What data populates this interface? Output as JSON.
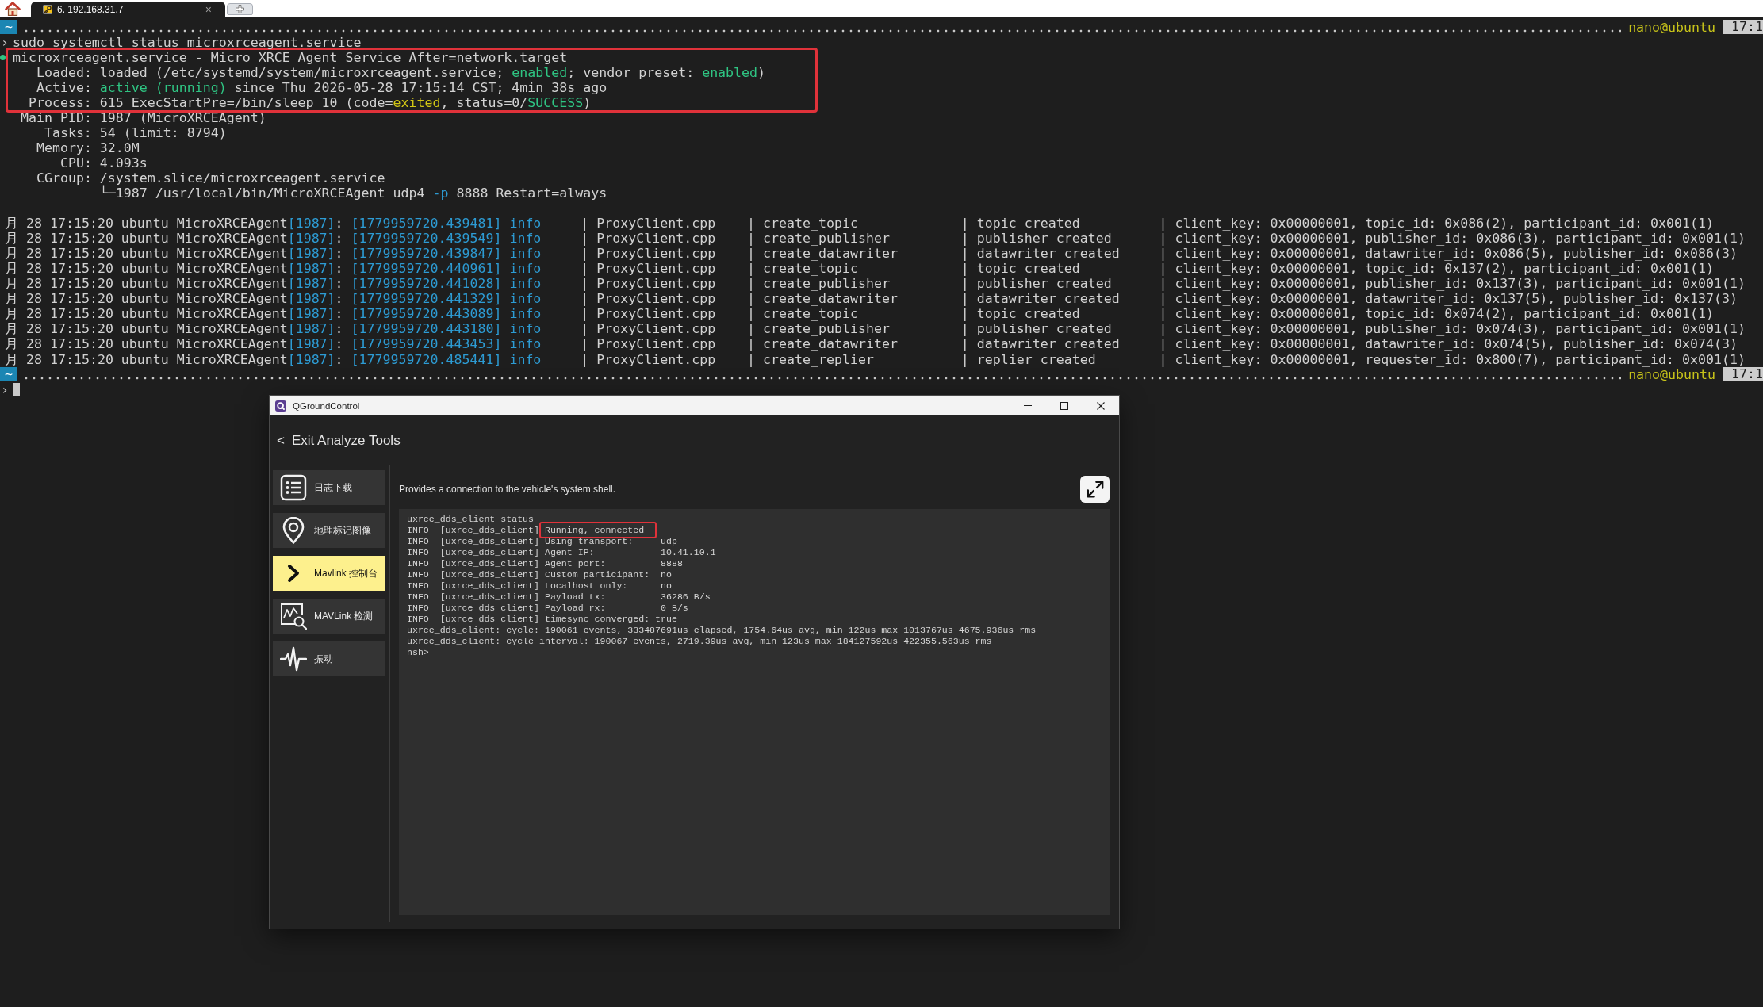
{
  "browser_tabs": [
    {
      "label": "6. 192.168.31.7",
      "close": "×",
      "selected": true
    }
  ],
  "terminal": {
    "lines": [
      {
        "kind": "prompt",
        "dir": "~",
        "user": "nano@ubuntu",
        "time": "17:1"
      },
      {
        "kind": "command",
        "prompt": "›",
        "text": "sudo systemctl status microxrceagent.service"
      },
      {
        "kind": "frame",
        "lines": [
          {
            "kind": "unit",
            "active": true,
            "segments": [
              {
                "kind": "plain",
                "text": "microxrceagent.service - Micro XRCE Agent Service After=network.target"
              }
            ]
          },
          {
            "kind": "field",
            "label": "Loaded:",
            "segments": [
              {
                "kind": "plain",
                "text": "loaded (/etc/systemd/system/microxrceagent.service; "
              },
              {
                "kind": "ok",
                "text": "enabled"
              },
              {
                "kind": "plain",
                "text": "; vendor preset: "
              },
              {
                "kind": "ok",
                "text": "enabled"
              },
              {
                "kind": "plain",
                "text": ")"
              }
            ]
          },
          {
            "kind": "field",
            "label": "Active:",
            "segments": [
              {
                "kind": "ok",
                "text": "active (running)"
              },
              {
                "kind": "plain",
                "text": " since Thu 2026-05-28 17:15:14 CST; 4min 38s ago"
              }
            ]
          },
          {
            "kind": "field",
            "label": "Process:",
            "segments": [
              {
                "kind": "plain",
                "text": "615 ExecStartPre=/bin/sleep 10 (code="
              },
              {
                "kind": "warn",
                "text": "exited"
              },
              {
                "kind": "plain",
                "text": ", status=0/"
              },
              {
                "kind": "ok",
                "text": "SUCCESS"
              },
              {
                "kind": "plain",
                "text": ")"
              }
            ]
          }
        ]
      },
      {
        "kind": "field",
        "label": "Main PID:",
        "segments": [
          {
            "kind": "plain",
            "text": "1987 (MicroXRCEAgent)"
          }
        ]
      },
      {
        "kind": "field",
        "label": "Tasks:",
        "segments": [
          {
            "kind": "plain",
            "text": "54 (limit: 8794)"
          }
        ]
      },
      {
        "kind": "field",
        "label": "Memory:",
        "segments": [
          {
            "kind": "plain",
            "text": "32.0M"
          }
        ]
      },
      {
        "kind": "field",
        "label": "CPU:",
        "segments": [
          {
            "kind": "plain",
            "text": "4.093s"
          }
        ]
      },
      {
        "kind": "field",
        "label": "CGroup:",
        "segments": [
          {
            "kind": "plain",
            "text": "/system.slice/microxrceagent.service"
          }
        ]
      },
      {
        "kind": "field",
        "segments": [
          {
            "kind": "plain",
            "text": "└─1987 /usr/local/bin/MicroXRCEAgent udp4 "
          },
          {
            "kind": "accent",
            "text": "-p"
          },
          {
            "kind": "plain",
            "text": " 8888 Restart=always"
          }
        ]
      },
      {
        "kind": "blank"
      },
      {
        "kind": "log",
        "segments": [
          {
            "kind": "plain",
            "text": "月 28 17:15:20 ubuntu MicroXRCEAgent"
          },
          {
            "kind": "accent",
            "text": "[1987]"
          },
          {
            "kind": "plain",
            "text": ": "
          },
          {
            "kind": "accent",
            "text": "[1779959720.439481] info"
          },
          {
            "kind": "plain",
            "text": "     | ProxyClient.cpp    | create_topic             | topic created          | client_key: 0x00000001, topic_id: 0x086(2), participant_id: 0x001(1)"
          }
        ]
      },
      {
        "kind": "log",
        "segments": [
          {
            "kind": "plain",
            "text": "月 28 17:15:20 ubuntu MicroXRCEAgent"
          },
          {
            "kind": "accent",
            "text": "[1987]"
          },
          {
            "kind": "plain",
            "text": ": "
          },
          {
            "kind": "accent",
            "text": "[1779959720.439549] info"
          },
          {
            "kind": "plain",
            "text": "     | ProxyClient.cpp    | create_publisher         | publisher created      | client_key: 0x00000001, publisher_id: 0x086(3), participant_id: 0x001(1)"
          }
        ]
      },
      {
        "kind": "log",
        "segments": [
          {
            "kind": "plain",
            "text": "月 28 17:15:20 ubuntu MicroXRCEAgent"
          },
          {
            "kind": "accent",
            "text": "[1987]"
          },
          {
            "kind": "plain",
            "text": ": "
          },
          {
            "kind": "accent",
            "text": "[1779959720.439847] info"
          },
          {
            "kind": "plain",
            "text": "     | ProxyClient.cpp    | create_datawriter        | datawriter created     | client_key: 0x00000001, datawriter_id: 0x086(5), publisher_id: 0x086(3)"
          }
        ]
      },
      {
        "kind": "log",
        "segments": [
          {
            "kind": "plain",
            "text": "月 28 17:15:20 ubuntu MicroXRCEAgent"
          },
          {
            "kind": "accent",
            "text": "[1987]"
          },
          {
            "kind": "plain",
            "text": ": "
          },
          {
            "kind": "accent",
            "text": "[1779959720.440961] info"
          },
          {
            "kind": "plain",
            "text": "     | ProxyClient.cpp    | create_topic             | topic created          | client_key: 0x00000001, topic_id: 0x137(2), participant_id: 0x001(1)"
          }
        ]
      },
      {
        "kind": "log",
        "segments": [
          {
            "kind": "plain",
            "text": "月 28 17:15:20 ubuntu MicroXRCEAgent"
          },
          {
            "kind": "accent",
            "text": "[1987]"
          },
          {
            "kind": "plain",
            "text": ": "
          },
          {
            "kind": "accent",
            "text": "[1779959720.441028] info"
          },
          {
            "kind": "plain",
            "text": "     | ProxyClient.cpp    | create_publisher         | publisher created      | client_key: 0x00000001, publisher_id: 0x137(3), participant_id: 0x001(1)"
          }
        ]
      },
      {
        "kind": "log",
        "segments": [
          {
            "kind": "plain",
            "text": "月 28 17:15:20 ubuntu MicroXRCEAgent"
          },
          {
            "kind": "accent",
            "text": "[1987]"
          },
          {
            "kind": "plain",
            "text": ": "
          },
          {
            "kind": "accent",
            "text": "[1779959720.441329] info"
          },
          {
            "kind": "plain",
            "text": "     | ProxyClient.cpp    | create_datawriter        | datawriter created     | client_key: 0x00000001, datawriter_id: 0x137(5), publisher_id: 0x137(3)"
          }
        ]
      },
      {
        "kind": "log",
        "segments": [
          {
            "kind": "plain",
            "text": "月 28 17:15:20 ubuntu MicroXRCEAgent"
          },
          {
            "kind": "accent",
            "text": "[1987]"
          },
          {
            "kind": "plain",
            "text": ": "
          },
          {
            "kind": "accent",
            "text": "[1779959720.443089] info"
          },
          {
            "kind": "plain",
            "text": "     | ProxyClient.cpp    | create_topic             | topic created          | client_key: 0x00000001, topic_id: 0x074(2), participant_id: 0x001(1)"
          }
        ]
      },
      {
        "kind": "log",
        "segments": [
          {
            "kind": "plain",
            "text": "月 28 17:15:20 ubuntu MicroXRCEAgent"
          },
          {
            "kind": "accent",
            "text": "[1987]"
          },
          {
            "kind": "plain",
            "text": ": "
          },
          {
            "kind": "accent",
            "text": "[1779959720.443180] info"
          },
          {
            "kind": "plain",
            "text": "     | ProxyClient.cpp    | create_publisher         | publisher created      | client_key: 0x00000001, publisher_id: 0x074(3), participant_id: 0x001(1)"
          }
        ]
      },
      {
        "kind": "log",
        "segments": [
          {
            "kind": "plain",
            "text": "月 28 17:15:20 ubuntu MicroXRCEAgent"
          },
          {
            "kind": "accent",
            "text": "[1987]"
          },
          {
            "kind": "plain",
            "text": ": "
          },
          {
            "kind": "accent",
            "text": "[1779959720.443453] info"
          },
          {
            "kind": "plain",
            "text": "     | ProxyClient.cpp    | create_datawriter        | datawriter created     | client_key: 0x00000001, datawriter_id: 0x074(5), publisher_id: 0x074(3)"
          }
        ]
      },
      {
        "kind": "log",
        "segments": [
          {
            "kind": "plain",
            "text": "月 28 17:15:20 ubuntu MicroXRCEAgent"
          },
          {
            "kind": "accent",
            "text": "[1987]"
          },
          {
            "kind": "plain",
            "text": ": "
          },
          {
            "kind": "accent",
            "text": "[1779959720.485441] info"
          },
          {
            "kind": "plain",
            "text": "     | ProxyClient.cpp    | create_replier           | replier created        | client_key: 0x00000001, requester_id: 0x800(7), participant_id: 0x001(1)"
          }
        ]
      },
      {
        "kind": "prompt",
        "dir": "~",
        "user": "nano@ubuntu",
        "time": "17:1"
      },
      {
        "kind": "input",
        "prompt": "›"
      }
    ]
  },
  "qgc_window": {
    "title": "QGroundControl",
    "back_button": {
      "arrow": "<",
      "label": "Exit Analyze Tools"
    },
    "sidebar": {
      "items": [
        {
          "label": "日志下载",
          "selected": false
        },
        {
          "label": "地理标记图像",
          "selected": false
        },
        {
          "label": "Mavlink 控制台",
          "selected": true
        },
        {
          "label": "MAVLink 检测",
          "selected": false
        },
        {
          "label": "振动",
          "selected": false
        }
      ]
    },
    "description": "Provides a connection to the vehicle's system shell.",
    "console": {
      "lines": [
        {
          "segments": [
            {
              "text": "uxrce_dds_client status",
              "highlighted": false
            }
          ]
        },
        {
          "segments": [
            {
              "text": "INFO  [uxrce_dds_client] ",
              "highlighted": false
            },
            {
              "text": "Running, connected",
              "highlighted": true
            }
          ]
        },
        {
          "segments": [
            {
              "text": "INFO  [uxrce_dds_client] Using transport:     udp",
              "highlighted": false
            }
          ]
        },
        {
          "segments": [
            {
              "text": "INFO  [uxrce_dds_client] Agent IP:            10.41.10.1",
              "highlighted": false
            }
          ]
        },
        {
          "segments": [
            {
              "text": "INFO  [uxrce_dds_client] Agent port:          8888",
              "highlighted": false
            }
          ]
        },
        {
          "segments": [
            {
              "text": "INFO  [uxrce_dds_client] Custom participant:  no",
              "highlighted": false
            }
          ]
        },
        {
          "segments": [
            {
              "text": "INFO  [uxrce_dds_client] Localhost only:      no",
              "highlighted": false
            }
          ]
        },
        {
          "segments": [
            {
              "text": "INFO  [uxrce_dds_client] Payload tx:          36286 B/s",
              "highlighted": false
            }
          ]
        },
        {
          "segments": [
            {
              "text": "INFO  [uxrce_dds_client] Payload rx:          0 B/s",
              "highlighted": false
            }
          ]
        },
        {
          "segments": [
            {
              "text": "INFO  [uxrce_dds_client] timesync converged: true",
              "highlighted": false
            }
          ]
        },
        {
          "segments": [
            {
              "text": "uxrce_dds_client: cycle: 190061 events, 333487691us elapsed, 1754.64us avg, min 122us max 1013767us 4675.936us rms",
              "highlighted": false
            }
          ]
        },
        {
          "segments": [
            {
              "text": "uxrce_dds_client: cycle interval: 190067 events, 2719.39us avg, min 123us max 184127592us 422355.563us rms",
              "highlighted": false
            }
          ]
        },
        {
          "segments": [
            {
              "text": "nsh>",
              "highlighted": false
            }
          ]
        }
      ]
    }
  }
}
